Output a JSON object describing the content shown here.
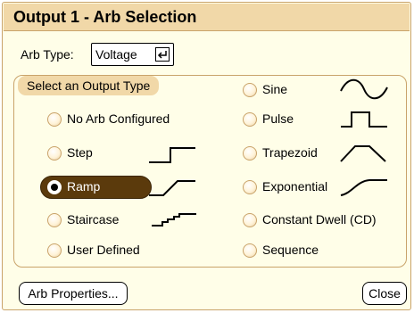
{
  "window": {
    "title": "Output 1 - Arb Selection"
  },
  "arb_type": {
    "label": "Arb Type:",
    "value": "Voltage",
    "enter_icon": "enter-key-icon"
  },
  "group": {
    "label": "Select an Output Type"
  },
  "options": {
    "no_arb": {
      "label": "No Arb Configured",
      "selected": false
    },
    "step": {
      "label": "Step",
      "selected": false,
      "icon": "step-wave-icon"
    },
    "ramp": {
      "label": "Ramp",
      "selected": true,
      "icon": "ramp-wave-icon"
    },
    "staircase": {
      "label": "Staircase",
      "selected": false,
      "icon": "staircase-wave-icon"
    },
    "user_defined": {
      "label": "User Defined",
      "selected": false
    },
    "sine": {
      "label": "Sine",
      "selected": false,
      "icon": "sine-wave-icon"
    },
    "pulse": {
      "label": "Pulse",
      "selected": false,
      "icon": "pulse-wave-icon"
    },
    "trapezoid": {
      "label": "Trapezoid",
      "selected": false,
      "icon": "trapezoid-wave-icon"
    },
    "exponential": {
      "label": "Exponential",
      "selected": false,
      "icon": "exponential-wave-icon"
    },
    "constant_dwell": {
      "label": "Constant Dwell (CD)",
      "selected": false
    },
    "sequence": {
      "label": "Sequence",
      "selected": false
    }
  },
  "buttons": {
    "arb_properties": "Arb Properties...",
    "close": "Close"
  },
  "colors": {
    "title_bar": "#f1d8a8",
    "panel_bg": "#fffee8",
    "border": "#c9a36a",
    "selected": "#5b3a0c"
  }
}
